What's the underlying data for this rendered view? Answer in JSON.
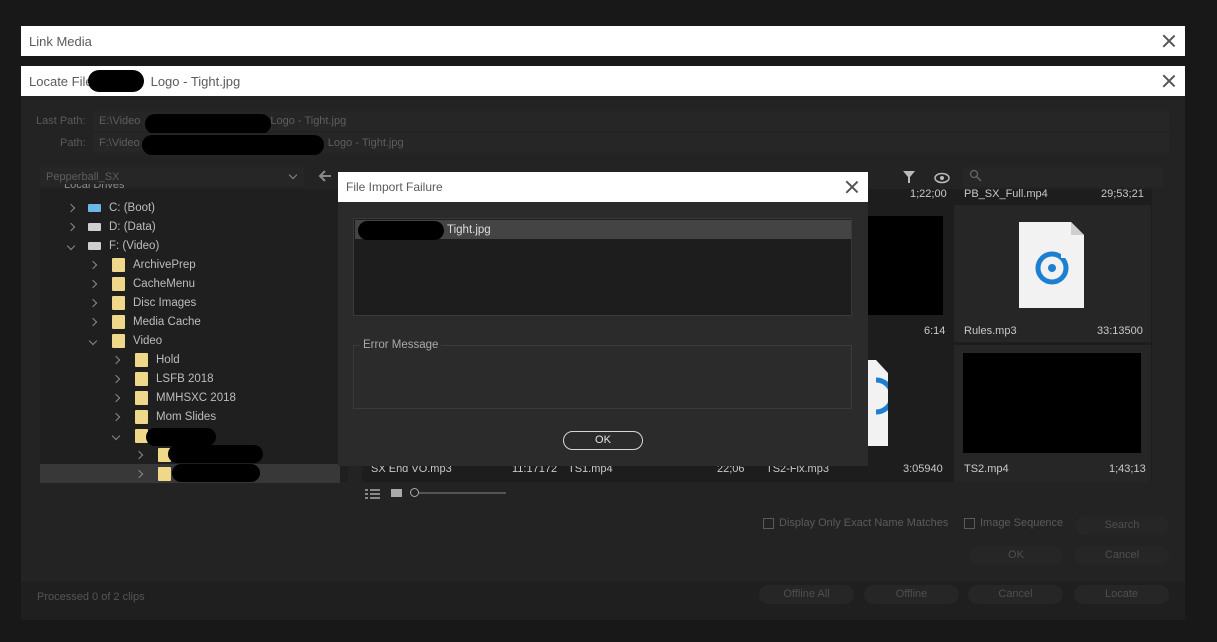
{
  "link_media": {
    "title": "Link Media"
  },
  "locate_file": {
    "title_prefix": "Locate File",
    "title_suffix": "Logo - Tight.jpg",
    "last_path_label": "Last Path:",
    "last_path_prefix": "E:\\Video",
    "last_path_suffix": "Logo - Tight.jpg",
    "path_label": "Path:",
    "path_prefix": "F:\\Video",
    "path_suffix": "Logo - Tight.jpg",
    "project_select": "Pepperball_SX",
    "tree": {
      "header": "Local Drives",
      "items": [
        {
          "label": "C: (Boot)"
        },
        {
          "label": "D: (Data)"
        },
        {
          "label": "F: (Video)"
        },
        {
          "label": "ArchivePrep"
        },
        {
          "label": "CacheMenu"
        },
        {
          "label": "Disc Images"
        },
        {
          "label": "Media Cache"
        },
        {
          "label": "Video"
        },
        {
          "label": "Hold"
        },
        {
          "label": "LSFB 2018"
        },
        {
          "label": "MMHSXC 2018"
        },
        {
          "label": "Mom Slides"
        }
      ]
    },
    "tiles": {
      "top_time_1": "1;22;00",
      "top_name_2": "PB_SX_Full.mp4",
      "top_time_2": "29;53;21",
      "mid_time_1": "6:14",
      "rules_name": "Rules.mp3",
      "rules_time": "33:13500",
      "sx_name": "SX End VO.mp3",
      "sx_time": "11:17172",
      "ts1_name": "TS1.mp4",
      "ts1_time": "22;06",
      "ts2fix_name": "TS2-Fix.mp3",
      "ts2fix_time": "3:05940",
      "ts2_name": "TS2.mp4",
      "ts2_time": "1;43;13"
    },
    "display_only_exact": "Display Only Exact Name Matches",
    "image_sequence": "Image Sequence",
    "search_button": "Search",
    "ok_button": "OK",
    "cancel_button": "Cancel"
  },
  "bottom": {
    "status": "Processed 0 of 2 clips",
    "offline_all": "Offline All",
    "offline": "Offline",
    "cancel": "Cancel",
    "locate": "Locate"
  },
  "dialog": {
    "title": "File Import Failure",
    "file_item_suffix": "Tight.jpg",
    "error_message_label": "Error Message",
    "ok_button": "OK"
  },
  "colors": {
    "accent_icon": "#1c7fd1",
    "folder": "#f0d88a",
    "title_bg": "#ffffff",
    "dialog_bg": "#2b2b2b"
  }
}
